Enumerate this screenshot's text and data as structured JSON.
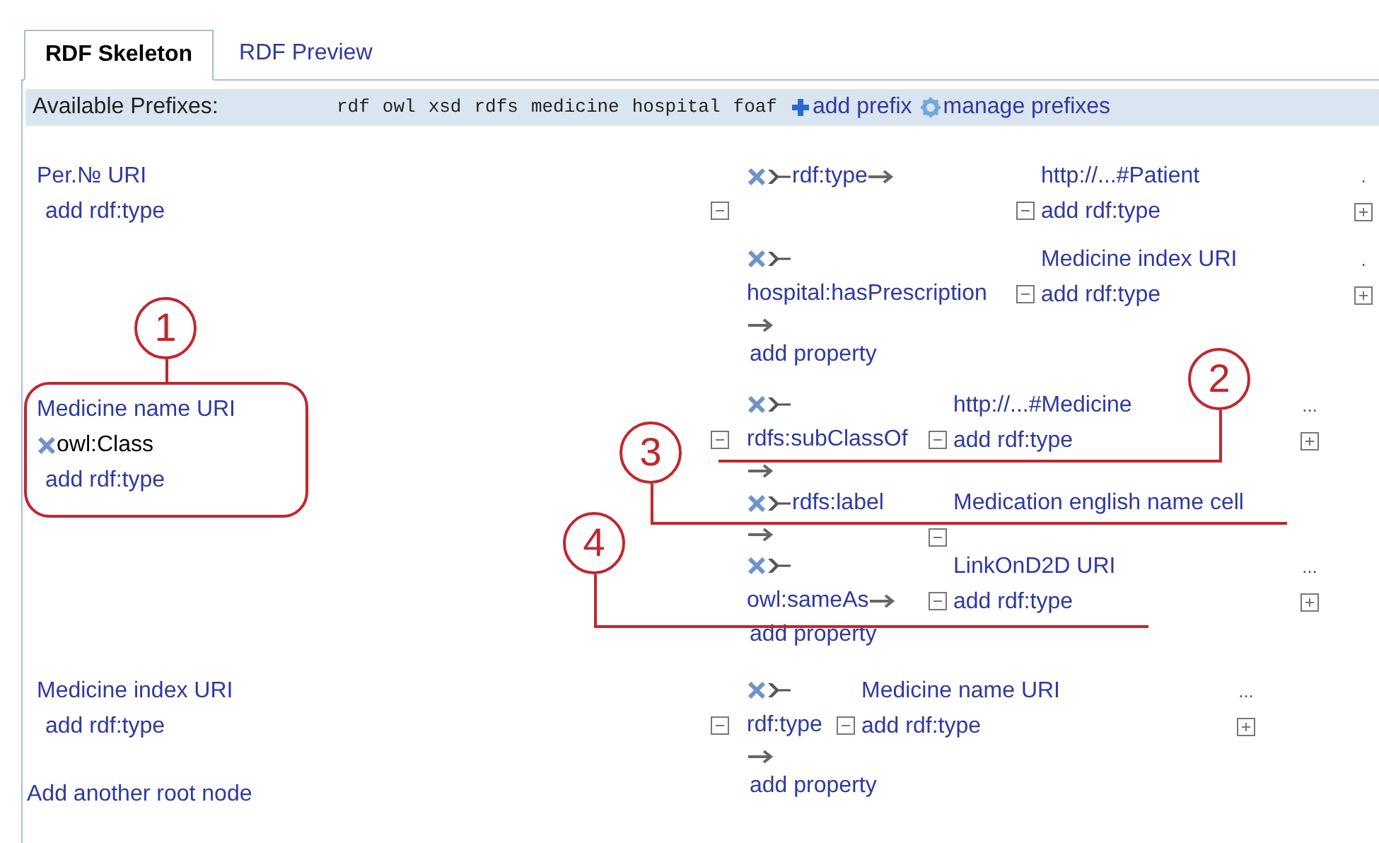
{
  "tabs": [
    {
      "label": "RDF Skeleton",
      "selected": true
    },
    {
      "label": "RDF Preview",
      "selected": false
    }
  ],
  "prefixes": {
    "label": "Available Prefixes:",
    "items": [
      "rdf",
      "owl",
      "xsd",
      "rdfs",
      "medicine",
      "hospital",
      "foaf"
    ],
    "actions": [
      {
        "kind": "add",
        "label": "add prefix"
      },
      {
        "kind": "manage",
        "label": "manage prefixes"
      }
    ]
  },
  "roots": [
    {
      "uri": "Per.№ URI",
      "add_type": "add rdf:type",
      "properties": [
        {
          "predicate": "rdf:type",
          "kind": "uri",
          "object": "http://...#Patient",
          "add_type": "add rdf:type",
          "more": "."
        },
        {
          "predicate": "hospital:hasPrescription",
          "kind": "uri",
          "object": "Medicine index URI",
          "add_type": "add rdf:type",
          "more": "."
        }
      ],
      "add_property": "add property"
    },
    {
      "uri": "Medicine name URI",
      "types": [
        "owl:Class"
      ],
      "add_type": "add rdf:type",
      "properties": [
        {
          "predicate": "rdfs:subClassOf",
          "kind": "uri",
          "object": "http://...#Medicine",
          "add_type": "add rdf:type",
          "more": "..."
        },
        {
          "predicate": "rdfs:label",
          "kind": "literal",
          "object": "Medication english name cell"
        },
        {
          "predicate": "owl:sameAs",
          "kind": "uri",
          "object": "LinkOnD2D URI",
          "add_type": "add rdf:type",
          "more": "..."
        }
      ],
      "add_property": "add property"
    },
    {
      "uri": "Medicine index URI",
      "add_type": "add rdf:type",
      "properties": [
        {
          "predicate": "rdf:type",
          "kind": "uri",
          "object": "Medicine name URI",
          "add_type": "add rdf:type",
          "more": "..."
        }
      ],
      "add_property": "add property"
    }
  ],
  "add_root": "Add another root node",
  "callouts": [
    {
      "number": "1"
    },
    {
      "number": "2"
    },
    {
      "number": "3"
    },
    {
      "number": "4"
    }
  ]
}
